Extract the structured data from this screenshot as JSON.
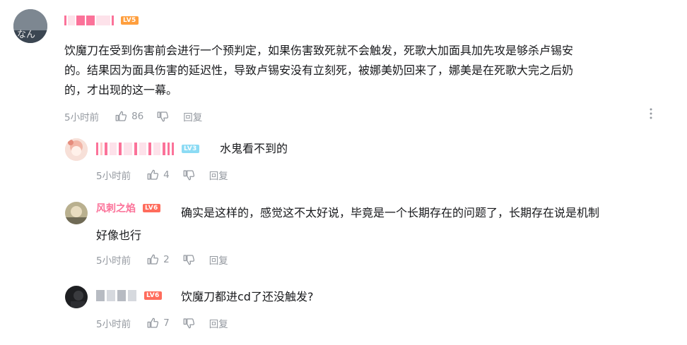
{
  "main_comment": {
    "level": "LV5",
    "text_line1": "饮魔刀在受到伤害前会进行一个预判定，如果伤害致死就不会触发，死歌大加面具加先攻是够杀卢锡安",
    "text_line2": "的。结果因为面具伤害的延迟性，导致卢锡安没有立刻死，被娜美奶回来了，娜美是在死歌大完之后奶",
    "text_line3": "的，才出现的这一幕。",
    "time": "5小时前",
    "likes": "86",
    "reply_label": "回复"
  },
  "replies": [
    {
      "level": "LV3",
      "text": "水鬼看不到的",
      "time": "5小时前",
      "likes": "4",
      "reply_label": "回复"
    },
    {
      "username": "风刺之焰",
      "level": "LV6",
      "text_line1": "确实是这样的，感觉这不太好说，毕竟是一个长期存在的问题了，长期存在说是机制",
      "text_line2": "好像也行",
      "time": "5小时前",
      "likes": "2",
      "reply_label": "回复"
    },
    {
      "level": "LV6",
      "text": "饮魔刀都进cd了还没触发?",
      "time": "5小时前",
      "likes": "7",
      "reply_label": "回复"
    }
  ],
  "colors": {
    "lv3": "#8cdbf4",
    "lv5": "#ff9f3e",
    "lv6": "#ff6c5c",
    "name_pink": "#fb7299",
    "meta": "#9499a0"
  }
}
